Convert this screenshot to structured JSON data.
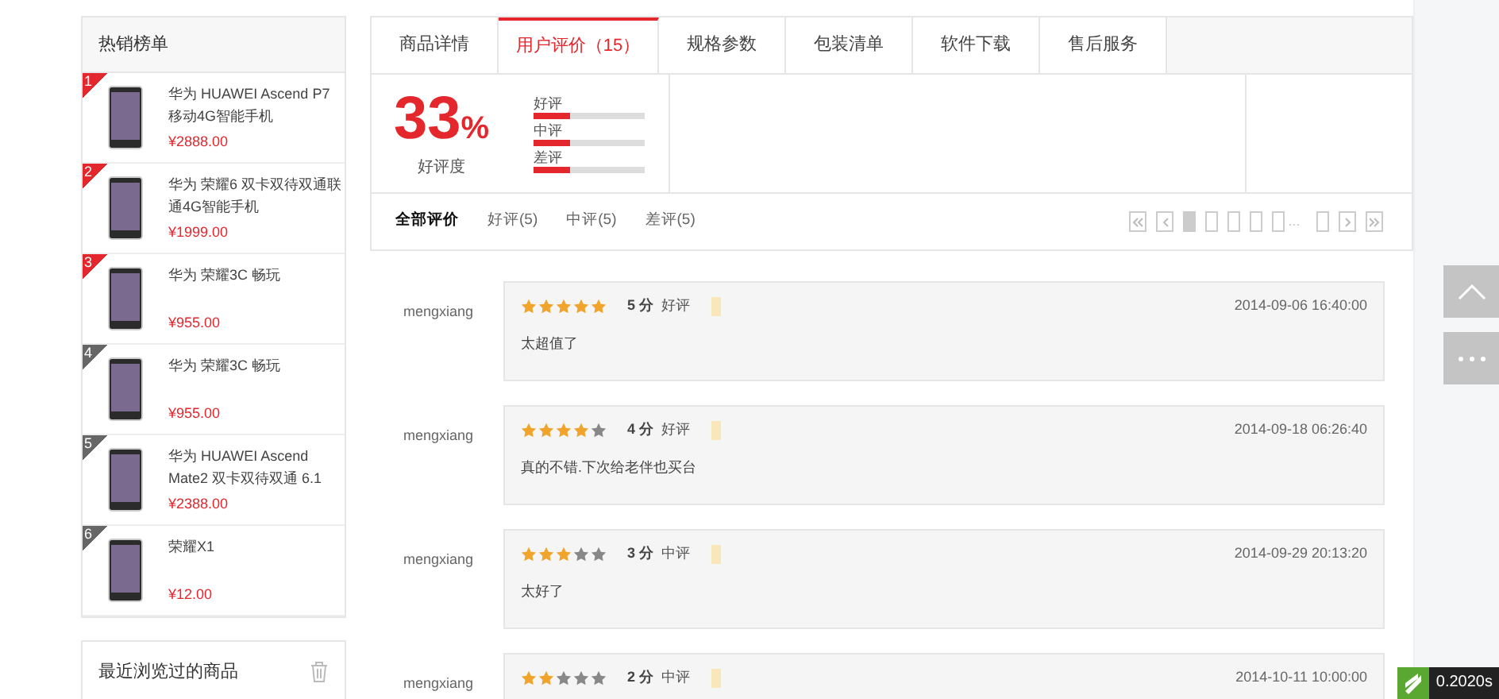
{
  "hot_list": {
    "title": "热销榜单",
    "items": [
      {
        "rank": "1",
        "color": "#e4262d",
        "name": "华为 HUAWEI Ascend P7 移动4G智能手机",
        "price": "¥2888.00"
      },
      {
        "rank": "2",
        "color": "#e4262d",
        "name": "华为 荣耀6 双卡双待双通联通4G智能手机",
        "price": "¥1999.00"
      },
      {
        "rank": "3",
        "color": "#e4262d",
        "name": "华为 荣耀3C 畅玩",
        "price": "¥955.00"
      },
      {
        "rank": "4",
        "color": "#666666",
        "name": "华为 荣耀3C 畅玩",
        "price": "¥955.00"
      },
      {
        "rank": "5",
        "color": "#666666",
        "name": "华为 HUAWEI Ascend Mate2 双卡双待双通 6.1",
        "price": "¥2388.00"
      },
      {
        "rank": "6",
        "color": "#666666",
        "name": "荣耀X1",
        "price": "¥12.00"
      }
    ]
  },
  "recent": {
    "title": "最近浏览过的商品"
  },
  "tabs": [
    {
      "label": "商品详情",
      "selected": false
    },
    {
      "label": "用户评价（15）",
      "selected": true
    },
    {
      "label": "规格参数",
      "selected": false
    },
    {
      "label": "包装清单",
      "selected": false
    },
    {
      "label": "软件下载",
      "selected": false
    },
    {
      "label": "售后服务",
      "selected": false
    }
  ],
  "summary": {
    "percent": "33",
    "percent_sign": "%",
    "caption": "好评度",
    "bars": [
      {
        "label": "好评",
        "level": 0.33
      },
      {
        "label": "中评",
        "level": 0.33
      },
      {
        "label": "差评",
        "level": 0.33
      }
    ]
  },
  "filters": [
    {
      "label": "全部评价",
      "selected": true
    },
    {
      "label": "好评(5)",
      "selected": false
    },
    {
      "label": "中评(5)",
      "selected": false
    },
    {
      "label": "差评(5)",
      "selected": false
    }
  ],
  "pagination": {
    "pages_before": [
      {
        "selected": true
      },
      {
        "selected": false
      },
      {
        "selected": false
      },
      {
        "selected": false
      },
      {
        "selected": false
      }
    ],
    "ellipsis": "…",
    "pages_after": [
      {
        "selected": false
      }
    ]
  },
  "reviews": [
    {
      "user": "mengxiang",
      "stars": 5,
      "score": "5 分",
      "grade": "好评",
      "date": "2014-09-06 16:40:00",
      "text": "太超值了"
    },
    {
      "user": "mengxiang",
      "stars": 4,
      "score": "4 分",
      "grade": "好评",
      "date": "2014-09-18 06:26:40",
      "text": "真的不错.下次给老伴也买台"
    },
    {
      "user": "mengxiang",
      "stars": 3,
      "score": "3 分",
      "grade": "中评",
      "date": "2014-09-29 20:13:20",
      "text": "太好了"
    },
    {
      "user": "mengxiang",
      "stars": 2,
      "score": "2 分",
      "grade": "中评",
      "date": "2014-10-11 10:00:00"
    }
  ],
  "timer": {
    "text": "0.2020s"
  }
}
